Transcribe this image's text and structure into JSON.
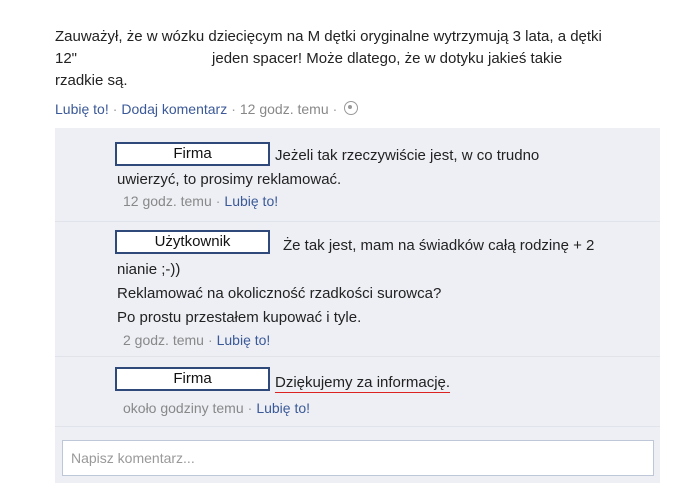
{
  "post": {
    "line1": "Zauważył, że w wózku dziecięcym na M dętki oryginalne wytrzymują 3 lata, a dętki",
    "line2_start": "12\"",
    "line2_end": "jeden spacer! Może dlatego, że w dotyku jakieś takie",
    "line3": "rzadkie są.",
    "like_label": "Lubię to!",
    "comment_label": "Dodaj komentarz",
    "time": "12 godz. temu",
    "separator": "·",
    "privacy_icon": "globe-icon"
  },
  "comments": [
    {
      "author": "Firma",
      "lines": [
        "Jeżeli tak rzeczywiście jest, w co trudno",
        "uwierzyć, to prosimy reklamować."
      ],
      "time": "12 godz. temu",
      "like_label": "Lubię to!"
    },
    {
      "author": "Użytkownik",
      "lines": [
        "Że tak jest, mam na świadków całą rodzinę + 2",
        "nianie ;-))",
        "Reklamować na okoliczność rzadkości surowca?",
        "Po prostu przestałem kupować i tyle."
      ],
      "time": "2 godz. temu",
      "like_label": "Lubię to!"
    },
    {
      "author": "Firma",
      "lines": [
        "Dziękujemy za informację."
      ],
      "time": "około godziny temu",
      "like_label": "Lubię to!"
    }
  ],
  "composer": {
    "placeholder": "Napisz komentarz..."
  }
}
